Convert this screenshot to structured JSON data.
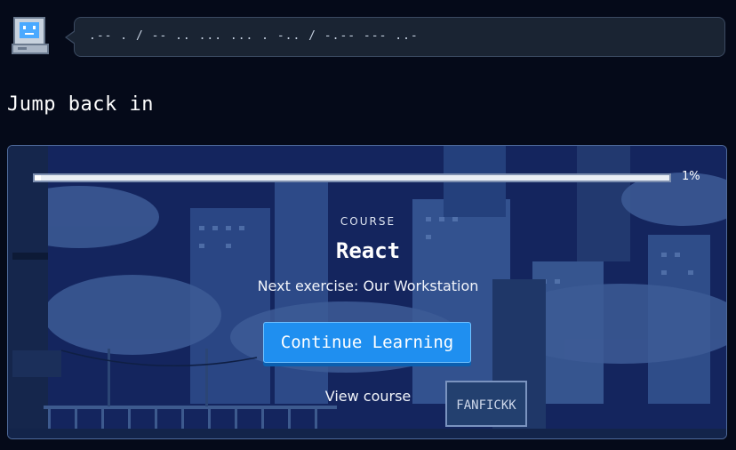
{
  "assistant": {
    "avatar_icon": "computer-mascot-icon",
    "message": ".-- . / -- .. ... ... . -.. / -.-- --- ..-"
  },
  "section": {
    "title": "Jump back in"
  },
  "course_card": {
    "progress": {
      "percent": 1,
      "label": "1%"
    },
    "eyebrow": "COURSE",
    "title": "React",
    "next_exercise": "Next exercise: Our Workstation",
    "cta_label": "Continue Learning",
    "secondary_link": "View course",
    "billboard_text": "FANFICKK",
    "colors": {
      "cta": "#1f8ff0",
      "card_border": "#4f6a9a",
      "bubble_bg": "#1a2433"
    }
  }
}
